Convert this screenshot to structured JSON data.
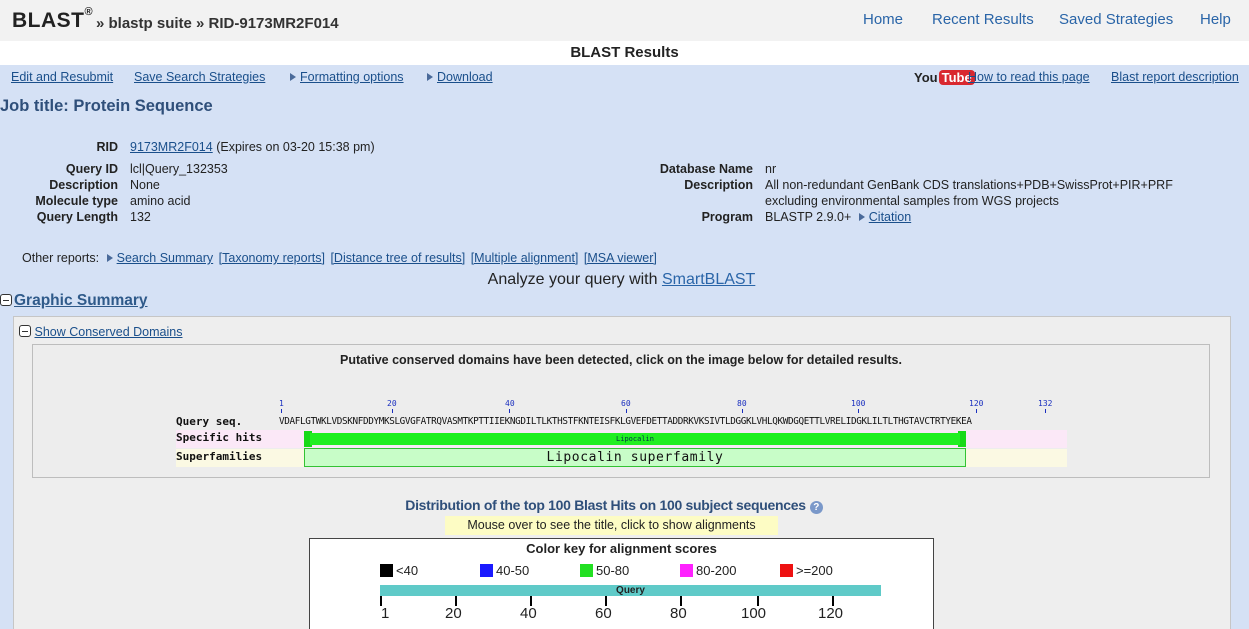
{
  "header": {
    "brand": "BLAST",
    "brand_mark": "®",
    "breadcrumb": "» blastp suite » RID-9173MR2F014",
    "nav": [
      "Home",
      "Recent Results",
      "Saved Strategies",
      "Help"
    ]
  },
  "results_title": "BLAST Results",
  "toolbar": {
    "edit": "Edit and Resubmit",
    "save": "Save Search Strategies",
    "formatting": "Formatting options",
    "download": "Download",
    "youtube_you": "You",
    "youtube_tube": "Tube",
    "how_to": "How to read this page",
    "report_desc": "Blast report description"
  },
  "job_title": "Job title: Protein Sequence",
  "info": {
    "rid_label": "RID",
    "rid_value": "9173MR2F014",
    "rid_expires": "(Expires on 03-20 15:38 pm)",
    "query_id_label": "Query ID",
    "query_id": "lcl|Query_132353",
    "description_label": "Description",
    "description": "None",
    "molecule_type_label": "Molecule type",
    "molecule_type": "amino acid",
    "query_length_label": "Query Length",
    "query_length": "132",
    "database_name_label": "Database Name",
    "database_name": "nr",
    "db_description_label": "Description",
    "db_description_line1": "All non-redundant GenBank CDS translations+PDB+SwissProt+PIR+PRF",
    "db_description_line2": "excluding environmental samples from WGS projects",
    "program_label": "Program",
    "program": "BLASTP 2.9.0+",
    "citation": "Citation"
  },
  "other_reports": {
    "label": "Other reports:",
    "links": [
      "Search Summary",
      "[Taxonomy reports]",
      "[Distance tree of results]",
      "[Multiple alignment]",
      "[MSA viewer]"
    ]
  },
  "smartblast": {
    "prefix": "Analyze your query with",
    "link": "SmartBLAST"
  },
  "graphic_summary": {
    "title": "Graphic Summary",
    "show_cd": "Show Conserved Domains",
    "cd_message": "Putative conserved domains have been detected, click on the image below for detailed results.",
    "ticks": [
      "1",
      "20",
      "40",
      "60",
      "80",
      "100",
      "120",
      "132"
    ],
    "query_label": "Query seq.",
    "query_sequence": "VDAFLGTWKLVDSKNFDDYMKSLGVGFATRQVASMTKPTTIIEKNGDILTLKTHSTFKNTEISFKLGVEFDETTADDRKVKSIVTLDGGKLVHLQKWDGQETTLVRELIDGKLILTLTHGTAVCTRTYEKEA",
    "specific_label": "Specific hits",
    "specific_hit": "Lipocalin",
    "superfamilies_label": "Superfamilies",
    "superfamily": "Lipocalin superfamily"
  },
  "distribution": {
    "title": "Distribution of the top 100 Blast Hits on 100 subject sequences",
    "help": "?",
    "mouseover": "Mouse over to see the title, click to show alignments",
    "color_key_title": "Color key for alignment scores",
    "keys": [
      {
        "label": "<40",
        "color": "#000000"
      },
      {
        "label": "40-50",
        "color": "#1a1aff"
      },
      {
        "label": "50-80",
        "color": "#22e022"
      },
      {
        "label": "80-200",
        "color": "#ff22ff"
      },
      {
        "label": ">=200",
        "color": "#ee1111"
      }
    ],
    "query_bar_label": "Query",
    "axis_ticks": [
      "1",
      "20",
      "40",
      "60",
      "80",
      "100",
      "120"
    ]
  }
}
